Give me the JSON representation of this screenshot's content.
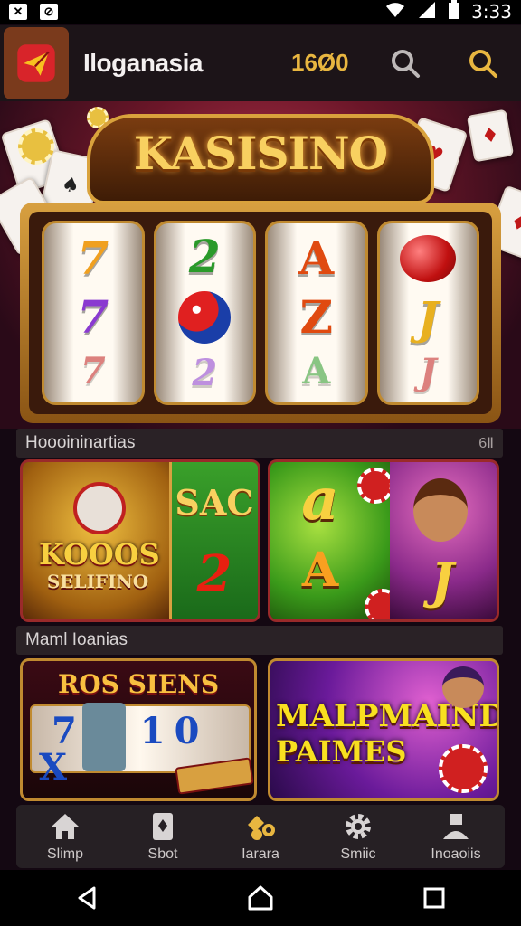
{
  "status_bar": {
    "time": "3:33"
  },
  "app_bar": {
    "title": "Iloganasia",
    "balance": "16Ø0",
    "logo_icon": "paper-plane-icon",
    "search_icon": "search-icon",
    "accent_color": "#e8b640"
  },
  "hero": {
    "banner_title": "KASISINO",
    "reels": [
      {
        "top": "7",
        "mid": "7",
        "bottom": "7"
      },
      {
        "top": "2",
        "mid": "orb",
        "bottom": "2"
      },
      {
        "top": "A",
        "mid": "Z",
        "bottom": "A"
      },
      {
        "top": "berry",
        "mid": "J",
        "bottom": "J"
      }
    ]
  },
  "section1": {
    "heading": "Hoooininartias",
    "right_label": "6Ⅱ",
    "tiles": [
      {
        "line1": "KOOOS",
        "line2": "SELIFINO"
      },
      {
        "line1": "SAC",
        "line2": "2"
      },
      {
        "line1": "a",
        "line2": "A"
      },
      {
        "line1": "J"
      }
    ]
  },
  "section2": {
    "heading": "Maml Ioanias",
    "tiles": [
      {
        "title": "ROS SIENS",
        "reel_text": "7 10 X"
      },
      {
        "line1": "MALPMAIND",
        "line2": "PAIMES"
      }
    ]
  },
  "bottom_nav": {
    "items": [
      {
        "label": "Slimp",
        "icon": "home-icon"
      },
      {
        "label": "Sbot",
        "icon": "card-icon"
      },
      {
        "label": "Iarara",
        "icon": "games-icon"
      },
      {
        "label": "Smiic",
        "icon": "gear-icon"
      },
      {
        "label": "Inoaoiis",
        "icon": "profile-icon"
      }
    ]
  }
}
